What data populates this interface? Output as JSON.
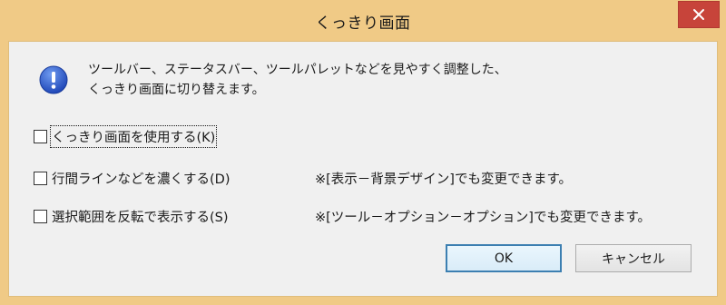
{
  "window": {
    "title": "くっきり画面",
    "close_symbol": "✕"
  },
  "message": {
    "line1": "ツールバー、ステータスバー、ツールパレットなどを見やすく調整した、",
    "line2": "くっきり画面に切り替えます。",
    "icon": "info-icon"
  },
  "options": [
    {
      "label": "くっきり画面を使用する(K)",
      "checked": false,
      "note": ""
    },
    {
      "label": "行間ラインなどを濃くする(D)",
      "checked": false,
      "note": "※[表示－背景デザイン]でも変更できます。"
    },
    {
      "label": "選択範囲を反転で表示する(S)",
      "checked": false,
      "note": "※[ツール－オプション－オプション]でも変更できます。"
    }
  ],
  "buttons": {
    "ok_label": "OK",
    "cancel_label": "キャンセル"
  },
  "colors": {
    "frame": "#f0ca86",
    "close": "#c7443a",
    "client": "#f0f0f0",
    "info_blue": "#2f5fd0",
    "default_button_border": "#3c7fb1"
  }
}
